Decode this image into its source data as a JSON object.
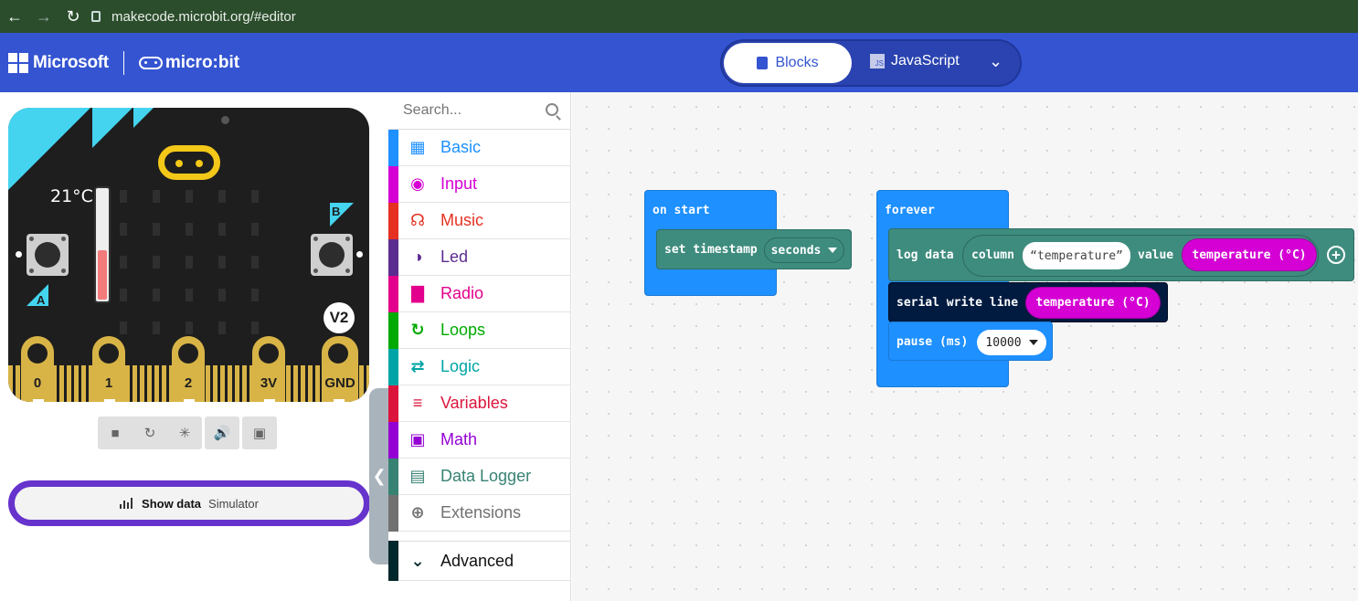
{
  "browser": {
    "url": "makecode.microbit.org/#editor"
  },
  "header": {
    "microsoft": "Microsoft",
    "microbit": "micro:bit",
    "blocks_label": "Blocks",
    "javascript_label": "JavaScript",
    "js_icon_text": "JS",
    "brand_color": "#3454d1"
  },
  "simulator": {
    "temperature": "21°C",
    "temperature_level": 0.45,
    "button_a": "A",
    "button_b": "B",
    "version": "V2",
    "pins": [
      "0",
      "1",
      "2",
      "3V",
      "GND"
    ],
    "controls": [
      "stop-icon",
      "restart-icon",
      "debug-icon",
      "sound-icon",
      "fullscreen-icon"
    ],
    "show_data_label": "Show data",
    "show_data_sub": "Simulator"
  },
  "toolbox": {
    "search_placeholder": "Search...",
    "categories": [
      {
        "label": "Basic",
        "color": "#1e90ff",
        "icon": "grid-icon"
      },
      {
        "label": "Input",
        "color": "#d400d4",
        "icon": "target-icon"
      },
      {
        "label": "Music",
        "color": "#e63022",
        "icon": "headphones-icon"
      },
      {
        "label": "Led",
        "color": "#5c2d91",
        "icon": "toggle-icon"
      },
      {
        "label": "Radio",
        "color": "#e3008c",
        "icon": "signal-icon"
      },
      {
        "label": "Loops",
        "color": "#00aa00",
        "icon": "refresh-icon"
      },
      {
        "label": "Logic",
        "color": "#00a4a6",
        "icon": "shuffle-icon"
      },
      {
        "label": "Variables",
        "color": "#dc143c",
        "icon": "lines-icon"
      },
      {
        "label": "Math",
        "color": "#9400d3",
        "icon": "calculator-icon"
      },
      {
        "label": "Data Logger",
        "color": "#378273",
        "icon": "table-icon"
      },
      {
        "label": "Extensions",
        "color": "#717171",
        "icon": "plus-circle-icon"
      },
      {
        "label": "Advanced",
        "color": "#00272b",
        "icon": "chevron-down-icon"
      }
    ]
  },
  "workspace": {
    "on_start": "on start",
    "set_timestamp": "set timestamp",
    "seconds": "seconds",
    "forever": "forever",
    "log_data": "log data",
    "column": "column",
    "temperature_str": "temperature",
    "value": "value",
    "temperature_c": "temperature (°C)",
    "serial_write_line": "serial write line",
    "temperature_c2": "temperature (°C)",
    "pause": "pause (ms)",
    "pause_value": "10000"
  }
}
